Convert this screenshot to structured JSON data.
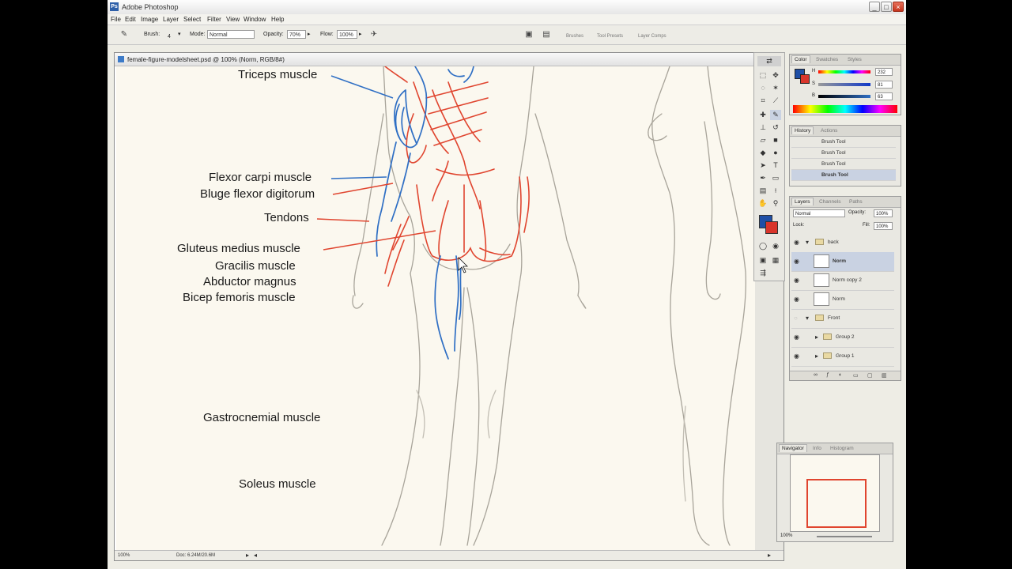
{
  "window": {
    "title": "Adobe Photoshop",
    "min": "_",
    "max": "□",
    "close": "×"
  },
  "menu": [
    "File",
    "Edit",
    "Image",
    "Layer",
    "Select",
    "Filter",
    "View",
    "Window",
    "Help"
  ],
  "options": {
    "brush_label": "Brush:",
    "brush_size": "4",
    "mode_label": "Mode:",
    "mode_value": "Normal",
    "opacity_label": "Opacity:",
    "opacity_value": "70%",
    "flow_label": "Flow:",
    "flow_value": "100%"
  },
  "palette_well": [
    "Brushes",
    "Tool Presets",
    "Layer Comps"
  ],
  "document": {
    "title": "female-figure-modelsheet.psd @ 100% (Norm, RGB/8#)",
    "zoom": "100%",
    "doc_size": "Doc: 6.24M/20.6M"
  },
  "annotations": [
    "Triceps muscle",
    "Flexor carpi muscle",
    "Bluge flexor digitorum",
    "Tendons",
    "Gluteus medius muscle",
    "Gracilis muscle",
    "Abductor magnus",
    "Bicep femoris muscle",
    "Gastrocnemial muscle",
    "Soleus muscle"
  ],
  "color_panel": {
    "tabs": [
      "Color",
      "Swatches",
      "Styles"
    ],
    "h_label": "H",
    "s_label": "S",
    "b_label": "B",
    "h_value": "232",
    "s_value": "81",
    "b_value": "63",
    "foreground": "#1f4fa6",
    "background": "#d9352b"
  },
  "history_panel": {
    "tabs": [
      "History",
      "Actions"
    ],
    "items": [
      "Brush Tool",
      "Brush Tool",
      "Brush Tool",
      "Brush Tool"
    ]
  },
  "layers_panel": {
    "tabs": [
      "Layers",
      "Channels",
      "Paths"
    ],
    "mode": "Normal",
    "opacity_label": "Opacity:",
    "opacity_value": "100%",
    "lock_label": "Lock:",
    "fill_label": "Fill:",
    "fill_value": "100%",
    "layers": [
      "back",
      "Norm",
      "Norm copy 2",
      "Norm",
      "Front",
      "Group 2",
      "Group 1"
    ]
  },
  "navigator_panel": {
    "tabs": [
      "Navigator",
      "Info",
      "Histogram"
    ],
    "zoom": "100%"
  },
  "colors": {
    "accent_blue": "#2f6fc4",
    "accent_red": "#e0452f"
  }
}
